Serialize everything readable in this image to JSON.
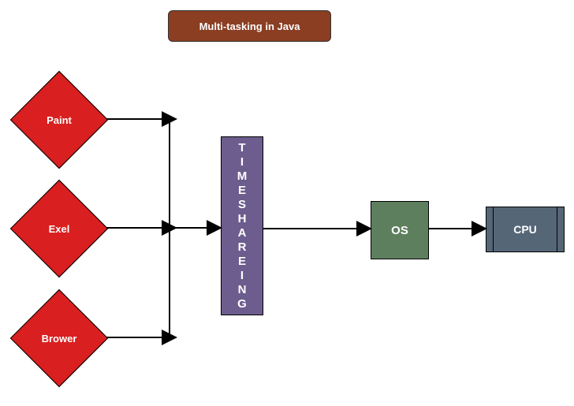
{
  "title": "Multi-tasking in Java",
  "apps": [
    {
      "label": "Paint"
    },
    {
      "label": "Exel"
    },
    {
      "label": "Brower"
    }
  ],
  "scheduler_chars": [
    "T",
    "I",
    "M",
    "E",
    "S",
    "H",
    "A",
    "R",
    "E",
    "I",
    "N",
    "G"
  ],
  "os_label": "OS",
  "cpu_label": "CPU"
}
